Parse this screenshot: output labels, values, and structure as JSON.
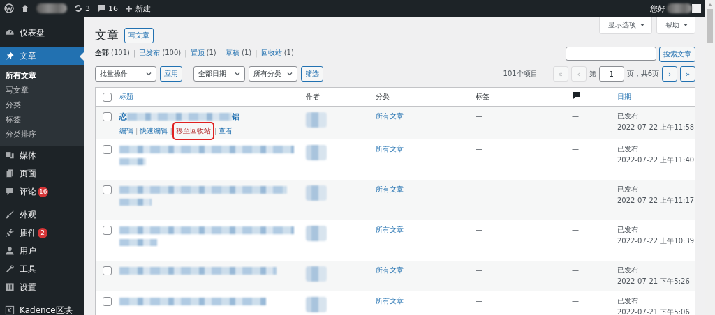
{
  "admin_bar": {
    "updates": "3",
    "comments": "16",
    "new": "新建",
    "greeting": "您好"
  },
  "sidebar": {
    "groups": [
      [
        {
          "label": "仪表盘",
          "selected": false
        }
      ],
      [
        {
          "label": "文章",
          "selected": true,
          "children": [
            {
              "label": "所有文章",
              "selected": true
            },
            {
              "label": "写文章",
              "selected": false
            },
            {
              "label": "分类",
              "selected": false
            },
            {
              "label": "标签",
              "selected": false
            },
            {
              "label": "分类排序",
              "selected": false
            }
          ]
        },
        {
          "label": "媒体",
          "selected": false
        },
        {
          "label": "页面",
          "selected": false
        },
        {
          "label": "评论",
          "selected": false,
          "badge": "16"
        }
      ],
      [
        {
          "label": "外观",
          "selected": false
        },
        {
          "label": "插件",
          "selected": false,
          "badge": "2"
        },
        {
          "label": "用户",
          "selected": false
        },
        {
          "label": "工具",
          "selected": false
        },
        {
          "label": "设置",
          "selected": false
        }
      ],
      [
        {
          "label": "Kadence区块",
          "selected": false
        }
      ]
    ]
  },
  "header": {
    "title": "文章",
    "add_new": "写文章",
    "screen_options": "显示选项",
    "help": "帮助"
  },
  "views": {
    "divider": "|",
    "items": [
      {
        "label": "全部",
        "count": "(101)",
        "selected": true
      },
      {
        "label": "已发布",
        "count": "(100)",
        "selected": false
      },
      {
        "label": "置顶",
        "count": "(1)",
        "selected": false
      },
      {
        "label": "草稿",
        "count": "(1)",
        "selected": false
      },
      {
        "label": "回收站",
        "count": "(1)",
        "selected": false
      }
    ]
  },
  "search": {
    "button": "搜索文章"
  },
  "filters": {
    "bulk_actions": "批量操作",
    "apply": "应用",
    "dates": "全部日期",
    "categories": "所有分类",
    "filter": "筛选"
  },
  "pagination": {
    "items": "101个项目",
    "prefix": "第",
    "page": "1",
    "suffix": "页，共6页",
    "buttons": [
      {
        "label": "«",
        "disabled": true
      },
      {
        "label": "‹",
        "disabled": true
      },
      {
        "label": "›",
        "disabled": false
      },
      {
        "label": "»",
        "disabled": false
      }
    ]
  },
  "table": {
    "select_all": {
      "checked": false
    },
    "action_divider": "|",
    "columns": [
      {
        "kind": "text",
        "label": "标题",
        "sortable": true
      },
      {
        "kind": "text",
        "label": "作者",
        "sortable": false
      },
      {
        "kind": "text",
        "label": "分类",
        "sortable": false
      },
      {
        "kind": "text",
        "label": "标签",
        "sortable": false
      },
      {
        "kind": "comment_icon"
      },
      {
        "kind": "text",
        "label": "日期",
        "sortable": true
      }
    ],
    "rows": [
      {
        "checked": false,
        "title_start": "恋",
        "title_end": "铝",
        "actions": [
          {
            "label": "编辑",
            "highlighted": false
          },
          {
            "label": "快速编辑",
            "highlighted": false
          },
          {
            "label": "移至回收站",
            "highlighted": true
          },
          {
            "label": "查看",
            "highlighted": false
          }
        ],
        "category": "所有文章",
        "tags": "—",
        "comments": "—",
        "status": "已发布",
        "date": "2022-07-22 上午11:58"
      },
      {
        "checked": false,
        "category": "所有文章",
        "tags": "—",
        "comments": "—",
        "status": "已发布",
        "date": "2022-07-22 上午11:40"
      },
      {
        "checked": false,
        "category": "所有文章",
        "tags": "—",
        "comments": "—",
        "status": "已发布",
        "date": "2022-07-22 上午11:17"
      },
      {
        "checked": false,
        "category": "所有文章",
        "tags": "—",
        "comments": "—",
        "status": "已发布",
        "date": "2022-07-22 上午10:39"
      },
      {
        "checked": false,
        "category": "所有文章",
        "tags": "—",
        "comments": "—",
        "status": "已发布",
        "date": "2022-07-21 下午5:26"
      },
      {
        "checked": false,
        "category": "所有文章",
        "tags": "—",
        "comments": "—",
        "status": "已发布",
        "date": "2022-07-21 下午5:06"
      }
    ]
  }
}
